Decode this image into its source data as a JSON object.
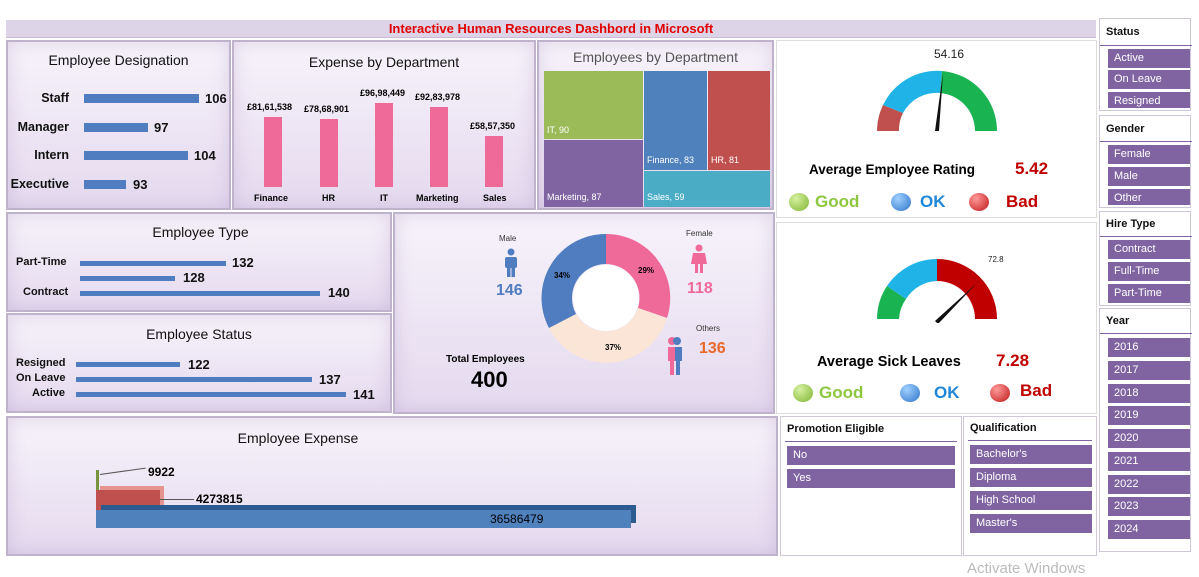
{
  "title": "Interactive Human Resources Dashbord in Microsoft",
  "designation": {
    "title": "Employee Designation",
    "items": [
      {
        "label": "Staff",
        "value": 106
      },
      {
        "label": "Manager",
        "value": 97
      },
      {
        "label": "Intern",
        "value": 104
      },
      {
        "label": "Executive",
        "value": 93
      }
    ]
  },
  "expense_dept": {
    "title": "Expense by Department",
    "items": [
      {
        "label": "Finance",
        "value": "£81,61,538"
      },
      {
        "label": "HR",
        "value": "£78,68,901"
      },
      {
        "label": "IT",
        "value": "£96,98,449"
      },
      {
        "label": "Marketing",
        "value": "£92,83,978"
      },
      {
        "label": "Sales",
        "value": "£58,57,350"
      }
    ]
  },
  "emp_dept": {
    "title": "Employees by Department",
    "items": [
      {
        "label": "IT, 90"
      },
      {
        "label": "Finance, 83"
      },
      {
        "label": "HR, 81"
      },
      {
        "label": "Marketing, 87"
      },
      {
        "label": "Sales, 59"
      }
    ]
  },
  "rating": {
    "value_top": "54.16",
    "title": "Average Employee Rating",
    "value": "5.42"
  },
  "sick": {
    "value_top": "72.8",
    "title": "Average Sick Leaves",
    "value": "7.28"
  },
  "legend": {
    "good": "Good",
    "ok": "OK",
    "bad": "Bad"
  },
  "emp_type": {
    "title": "Employee Type",
    "items": [
      {
        "label": "Part-Time",
        "value": "132"
      },
      {
        "label": "",
        "value": "128"
      },
      {
        "label": "Contract",
        "value": "140"
      }
    ]
  },
  "emp_status": {
    "title": "Employee Status",
    "items": [
      {
        "label": "Resigned",
        "value": "122"
      },
      {
        "label": "On Leave",
        "value": "137"
      },
      {
        "label": "Active",
        "value": "141"
      }
    ]
  },
  "gender": {
    "male_label": "Male",
    "male_value": "146",
    "female_label": "Female",
    "female_value": "118",
    "others_label": "Others",
    "others_value": "136",
    "pct_male": "34%",
    "pct_female": "29%",
    "pct_others": "37%",
    "total_label": "Total Employees",
    "total_value": "400"
  },
  "emp_expense": {
    "title": "Employee Expense",
    "items": [
      {
        "value": "9922"
      },
      {
        "value": "4273815"
      },
      {
        "value": "36586479"
      }
    ]
  },
  "promotion": {
    "title": "Promotion Eligible",
    "items": [
      "No",
      "Yes"
    ]
  },
  "qualification": {
    "title": "Qualification",
    "items": [
      "Bachelor's",
      "Diploma",
      "High School",
      "Master's"
    ]
  },
  "status_slicer": {
    "title": "Status",
    "items": [
      "Active",
      "On Leave",
      "Resigned"
    ]
  },
  "gender_slicer": {
    "title": "Gender",
    "items": [
      "Female",
      "Male",
      "Other"
    ]
  },
  "hire_slicer": {
    "title": "Hire Type",
    "items": [
      "Contract",
      "Full-Time",
      "Part-Time"
    ]
  },
  "year_slicer": {
    "title": "Year",
    "items": [
      "2016",
      "2017",
      "2018",
      "2019",
      "2020",
      "2021",
      "2022",
      "2023",
      "2024"
    ]
  },
  "watermark": "Activate Windows",
  "chart_data": [
    {
      "type": "bar",
      "title": "Employee Designation",
      "categories": [
        "Staff",
        "Manager",
        "Intern",
        "Executive"
      ],
      "values": [
        106,
        97,
        104,
        93
      ]
    },
    {
      "type": "bar",
      "title": "Expense by Department",
      "categories": [
        "Finance",
        "HR",
        "IT",
        "Marketing",
        "Sales"
      ],
      "values": [
        8161538,
        7868901,
        9698449,
        9283978,
        5857350
      ]
    },
    {
      "type": "bar",
      "title": "Employee Type",
      "categories": [
        "Part-Time",
        "",
        "Contract"
      ],
      "values": [
        132,
        128,
        140
      ]
    },
    {
      "type": "bar",
      "title": "Employee Status",
      "categories": [
        "Resigned",
        "On Leave",
        "Active"
      ],
      "values": [
        122,
        137,
        141
      ]
    },
    {
      "type": "pie",
      "categories": [
        "Male",
        "Female",
        "Others"
      ],
      "values": [
        34,
        29,
        37
      ]
    },
    {
      "type": "bar",
      "title": "Employee Expense",
      "values": [
        9922,
        4273815,
        36586479
      ]
    }
  ],
  "colors": {
    "accent": "#8064a2",
    "title_red": "#e00000",
    "bar_blue": "#4f7dbf",
    "bar_pink": "#f06a99",
    "male": "#4f7dbf",
    "female": "#f06a99",
    "others": "#e8692b"
  }
}
